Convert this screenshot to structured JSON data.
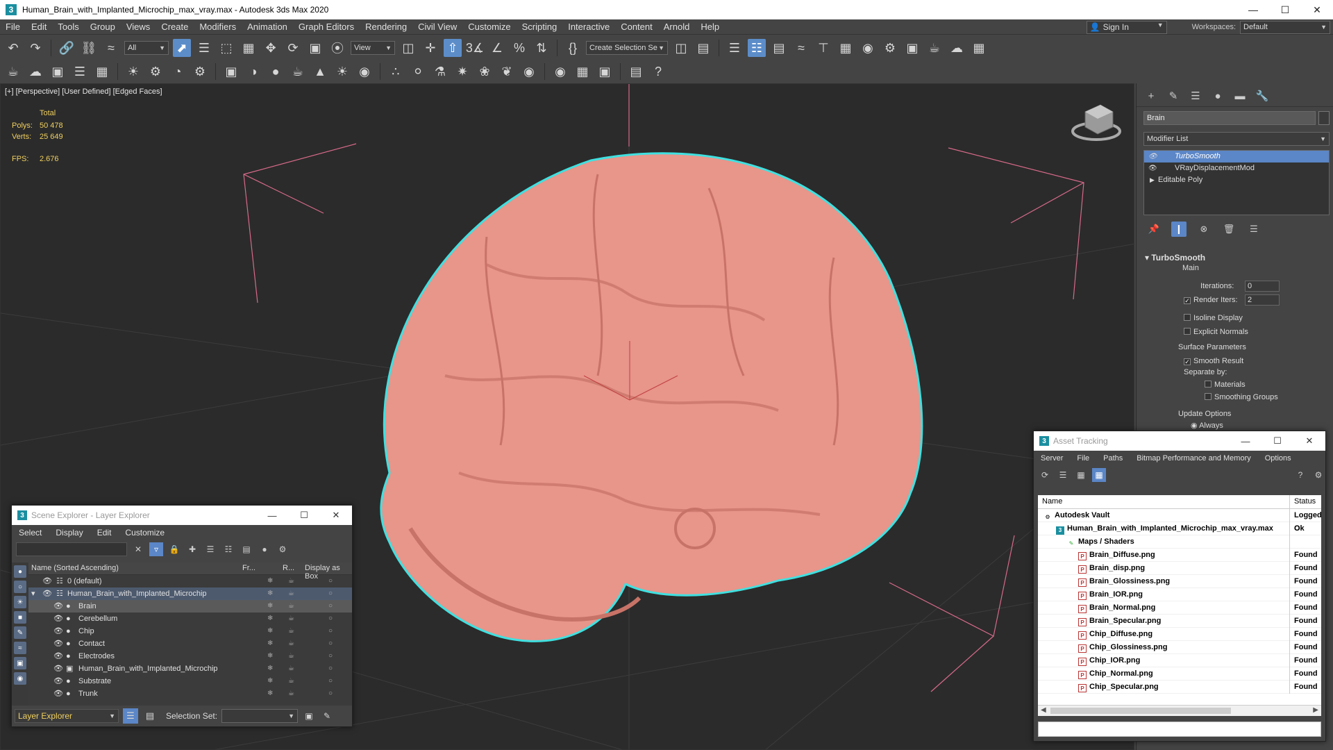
{
  "window": {
    "title": "Human_Brain_with_Implanted_Microchip_max_vray.max - Autodesk 3ds Max 2020",
    "app_icon": "3"
  },
  "menu": [
    "File",
    "Edit",
    "Tools",
    "Group",
    "Views",
    "Create",
    "Modifiers",
    "Animation",
    "Graph Editors",
    "Rendering",
    "Civil View",
    "Customize",
    "Scripting",
    "Interactive",
    "Content",
    "Arnold",
    "Help"
  ],
  "account": {
    "sign_in": "Sign In",
    "workspaces_label": "Workspaces:",
    "workspace": "Default"
  },
  "toolbar": {
    "filter": "All",
    "refcoord": "View",
    "selection_set": "Create Selection Se"
  },
  "viewport": {
    "label": "[+] [Perspective] [User Defined] [Edged Faces]",
    "stats_header": "Total",
    "polys_label": "Polys:",
    "polys": "50 478",
    "verts_label": "Verts:",
    "verts": "25 649",
    "fps_label": "FPS:",
    "fps": "2.676"
  },
  "command_panel": {
    "object_name": "Brain",
    "modifier_list": "Modifier List",
    "stack": [
      "TurboSmooth",
      "VRayDisplacementMod",
      "Editable Poly"
    ],
    "rollout": "TurboSmooth",
    "main_label": "Main",
    "iterations_label": "Iterations:",
    "iterations": "0",
    "render_iters_label": "Render Iters:",
    "render_iters": "2",
    "isoline": "Isoline Display",
    "explicit": "Explicit Normals",
    "surface_label": "Surface Parameters",
    "smooth_result": "Smooth Result",
    "separate_by": "Separate by:",
    "materials": "Materials",
    "smoothing_groups": "Smoothing Groups",
    "update_label": "Update Options",
    "always": "Always"
  },
  "scene_explorer": {
    "title": "Scene Explorer - Layer Explorer",
    "menu": [
      "Select",
      "Display",
      "Edit",
      "Customize"
    ],
    "columns": {
      "name": "Name (Sorted Ascending)",
      "frozen": "Fr...",
      "render": "R...",
      "box": "Display as Box"
    },
    "rows": [
      {
        "name": "0 (default)",
        "indent": 0
      },
      {
        "name": "Human_Brain_with_Implanted_Microchip",
        "indent": 0
      },
      {
        "name": "Brain",
        "indent": 1
      },
      {
        "name": "Cerebellum",
        "indent": 1
      },
      {
        "name": "Chip",
        "indent": 1
      },
      {
        "name": "Contact",
        "indent": 1
      },
      {
        "name": "Electrodes",
        "indent": 1
      },
      {
        "name": "Human_Brain_with_Implanted_Microchip",
        "indent": 1
      },
      {
        "name": "Substrate",
        "indent": 1
      },
      {
        "name": "Trunk",
        "indent": 1
      }
    ],
    "footer_layer": "Layer Explorer",
    "selection_set_label": "Selection Set:"
  },
  "asset_tracking": {
    "title": "Asset Tracking",
    "menu": [
      "Server",
      "File",
      "Paths",
      "Bitmap Performance and Memory",
      "Options"
    ],
    "columns": {
      "name": "Name",
      "status": "Status"
    },
    "rows": [
      {
        "name": "Autodesk Vault",
        "status": "Logged O",
        "level": 0
      },
      {
        "name": "Human_Brain_with_Implanted_Microchip_max_vray.max",
        "status": "Ok",
        "level": 1
      },
      {
        "name": "Maps / Shaders",
        "status": "",
        "level": 2
      },
      {
        "name": "Brain_Diffuse.png",
        "status": "Found",
        "level": 3
      },
      {
        "name": "Brain_disp.png",
        "status": "Found",
        "level": 3
      },
      {
        "name": "Brain_Glossiness.png",
        "status": "Found",
        "level": 3
      },
      {
        "name": "Brain_IOR.png",
        "status": "Found",
        "level": 3
      },
      {
        "name": "Brain_Normal.png",
        "status": "Found",
        "level": 3
      },
      {
        "name": "Brain_Specular.png",
        "status": "Found",
        "level": 3
      },
      {
        "name": "Chip_Diffuse.png",
        "status": "Found",
        "level": 3
      },
      {
        "name": "Chip_Glossiness.png",
        "status": "Found",
        "level": 3
      },
      {
        "name": "Chip_IOR.png",
        "status": "Found",
        "level": 3
      },
      {
        "name": "Chip_Normal.png",
        "status": "Found",
        "level": 3
      },
      {
        "name": "Chip_Specular.png",
        "status": "Found",
        "level": 3
      }
    ]
  },
  "colors": {
    "accent": "#5b86c7",
    "stats": "#f0d060",
    "selection_outline": "#40e0e0",
    "brain": "#e8958a"
  }
}
